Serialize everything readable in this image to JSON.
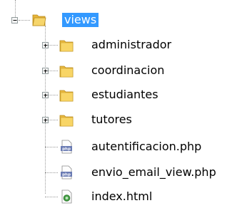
{
  "tree": {
    "root": {
      "label": "views",
      "expanded": true,
      "selected": true,
      "icon": "folder-icon"
    },
    "children": [
      {
        "label": "administrador",
        "type": "folder",
        "expanded": false,
        "icon": "folder-icon"
      },
      {
        "label": "coordinacion",
        "type": "folder",
        "expanded": false,
        "icon": "folder-icon"
      },
      {
        "label": "estudiantes",
        "type": "folder",
        "expanded": false,
        "icon": "folder-icon"
      },
      {
        "label": "tutores",
        "type": "folder",
        "expanded": false,
        "icon": "folder-icon"
      },
      {
        "label": "autentificacion.php",
        "type": "file",
        "icon": "php-file-icon"
      },
      {
        "label": "envio_email_view.php",
        "type": "file",
        "icon": "php-file-icon"
      },
      {
        "label": "index.html",
        "type": "file",
        "icon": "html-file-icon"
      }
    ]
  },
  "colors": {
    "selection": "#3399ff",
    "folder": "#f2c94c",
    "php_icon": "#6a7bb3"
  }
}
